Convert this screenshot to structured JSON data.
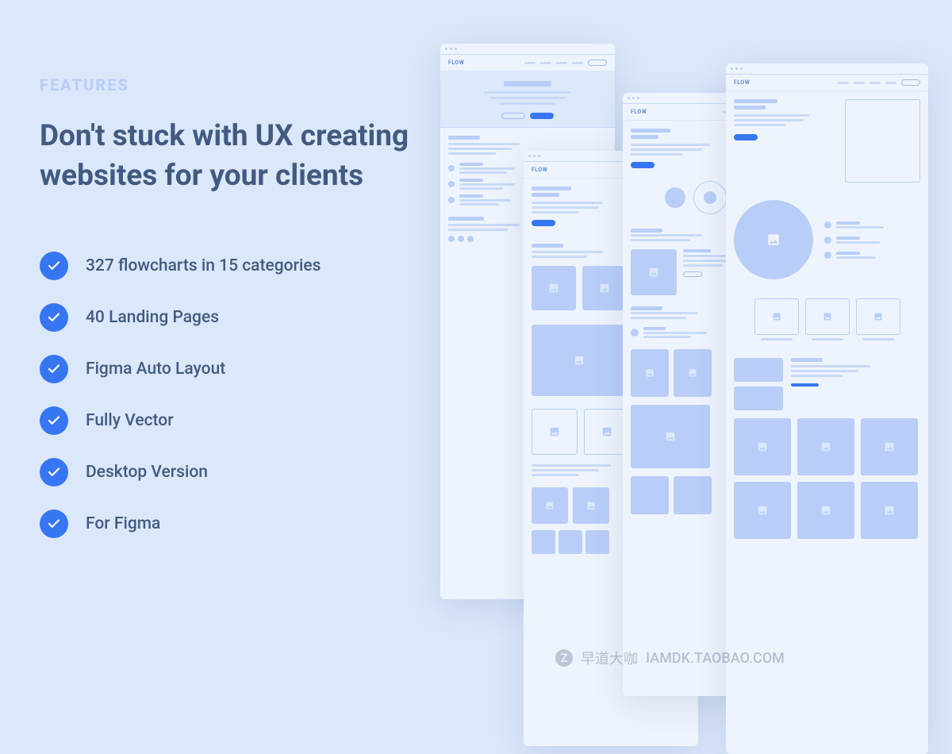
{
  "eyebrow": "FEATURES",
  "heading": "Don't stuck with UX creating websites for your clients",
  "features": [
    {
      "label": "327 flowcharts in 15 categories"
    },
    {
      "label": "40 Landing Pages"
    },
    {
      "label": "Figma Auto Layout"
    },
    {
      "label": "Fully Vector"
    },
    {
      "label": "Desktop Version"
    },
    {
      "label": "For Figma"
    }
  ],
  "mock_logo": "FLOW",
  "watermark": {
    "badge": "Z",
    "text1": "早道大咖",
    "text2": "IAMDK.TAOBAO.COM"
  }
}
